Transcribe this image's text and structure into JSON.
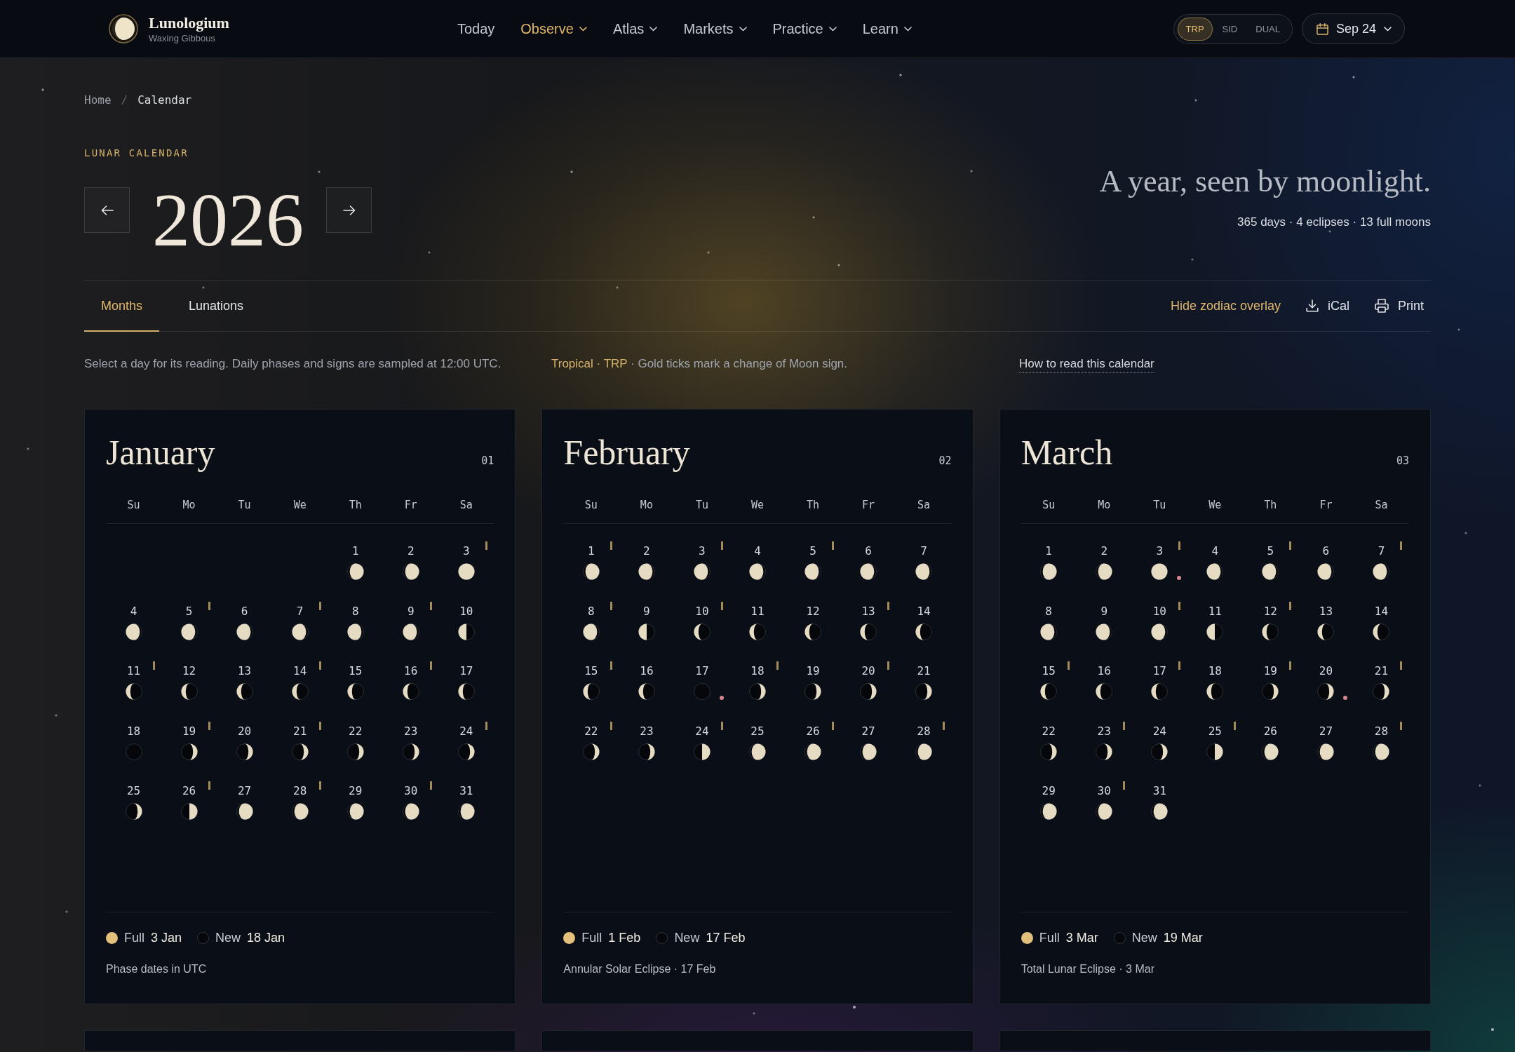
{
  "header": {
    "brand": {
      "name": "Lunologium",
      "subtitle": "Waxing Gibbous"
    },
    "nav": [
      {
        "label": "Today",
        "selected": false,
        "dropdown": false
      },
      {
        "label": "Observe",
        "selected": true,
        "dropdown": true
      },
      {
        "label": "Atlas",
        "selected": false,
        "dropdown": true
      },
      {
        "label": "Markets",
        "selected": false,
        "dropdown": true
      },
      {
        "label": "Practice",
        "selected": false,
        "dropdown": true
      },
      {
        "label": "Learn",
        "selected": false,
        "dropdown": true
      }
    ],
    "zodiac_modes": [
      {
        "label": "TRP",
        "selected": true
      },
      {
        "label": "SID",
        "selected": false
      },
      {
        "label": "DUAL",
        "selected": false
      }
    ],
    "date_button": {
      "label": "Sep 24"
    }
  },
  "breadcrumb": {
    "separator": "/",
    "items": [
      {
        "label": "Home",
        "current": false
      },
      {
        "label": "Calendar",
        "current": true
      }
    ]
  },
  "hero": {
    "eyebrow": "LUNAR CALENDAR",
    "year": "2026",
    "tagline": "A year, seen by moonlight.",
    "stats": "365 days · 4 eclipses · 13 full moons"
  },
  "view_tabs": [
    {
      "label": "Months",
      "selected": true
    },
    {
      "label": "Lunations",
      "selected": false
    }
  ],
  "actions": [
    {
      "kind": "toggle",
      "label": "Hide zodiac overlay"
    },
    {
      "kind": "download",
      "label": "iCal"
    },
    {
      "kind": "print",
      "label": "Print"
    }
  ],
  "info": {
    "note": "Select a day for its reading. Daily phases and signs are sampled at 12:00 UTC.",
    "zodiac": "Tropical · TRP",
    "zodiac_note": "· Gold ticks mark a change of Moon sign.",
    "help_link": "How to read this calendar"
  },
  "months": [
    {
      "kind": "month",
      "name": "January",
      "number": "01",
      "weekdays": [
        "Su",
        "Mo",
        "Tu",
        "We",
        "Th",
        "Fr",
        "Sa"
      ],
      "days": [
        {
          "kind": "blank"
        },
        {
          "kind": "blank"
        },
        {
          "kind": "blank"
        },
        {
          "kind": "blank"
        },
        {
          "kind": "waxing-gibbous",
          "label": "1",
          "tick": false,
          "event": false
        },
        {
          "kind": "waxing-gibbous",
          "label": "2",
          "tick": false,
          "event": false
        },
        {
          "kind": "full",
          "label": "3",
          "tick": true,
          "event": false
        },
        {
          "kind": "waning-gibbous",
          "label": "4",
          "tick": false,
          "event": false
        },
        {
          "kind": "waning-gibbous",
          "label": "5",
          "tick": true,
          "event": false
        },
        {
          "kind": "waning-gibbous",
          "label": "6",
          "tick": false,
          "event": false
        },
        {
          "kind": "waning-gibbous",
          "label": "7",
          "tick": true,
          "event": false
        },
        {
          "kind": "waning-gibbous",
          "label": "8",
          "tick": false,
          "event": false
        },
        {
          "kind": "waning-gibbous",
          "label": "9",
          "tick": true,
          "event": false
        },
        {
          "kind": "last-quarter",
          "label": "10",
          "tick": false,
          "event": false
        },
        {
          "kind": "waning-crescent",
          "label": "11",
          "tick": true,
          "event": false
        },
        {
          "kind": "waning-crescent",
          "label": "12",
          "tick": false,
          "event": false
        },
        {
          "kind": "waning-crescent",
          "label": "13",
          "tick": false,
          "event": false
        },
        {
          "kind": "waning-crescent",
          "label": "14",
          "tick": true,
          "event": false
        },
        {
          "kind": "waning-crescent",
          "label": "15",
          "tick": false,
          "event": false
        },
        {
          "kind": "waning-crescent",
          "label": "16",
          "tick": true,
          "event": false
        },
        {
          "kind": "waning-crescent",
          "label": "17",
          "tick": false,
          "event": false
        },
        {
          "kind": "new",
          "label": "18",
          "tick": false,
          "event": false
        },
        {
          "kind": "waxing-crescent",
          "label": "19",
          "tick": true,
          "event": false
        },
        {
          "kind": "waxing-crescent",
          "label": "20",
          "tick": false,
          "event": false
        },
        {
          "kind": "waxing-crescent",
          "label": "21",
          "tick": true,
          "event": false
        },
        {
          "kind": "waxing-crescent",
          "label": "22",
          "tick": false,
          "event": false
        },
        {
          "kind": "waxing-crescent",
          "label": "23",
          "tick": false,
          "event": false
        },
        {
          "kind": "waxing-crescent",
          "label": "24",
          "tick": true,
          "event": false
        },
        {
          "kind": "waxing-crescent",
          "label": "25",
          "tick": false,
          "event": false
        },
        {
          "kind": "first-quarter",
          "label": "26",
          "tick": true,
          "event": false
        },
        {
          "kind": "waxing-gibbous",
          "label": "27",
          "tick": false,
          "event": false
        },
        {
          "kind": "waxing-gibbous",
          "label": "28",
          "tick": true,
          "event": false
        },
        {
          "kind": "waxing-gibbous",
          "label": "29",
          "tick": false,
          "event": false
        },
        {
          "kind": "waxing-gibbous",
          "label": "30",
          "tick": true,
          "event": false
        },
        {
          "kind": "waxing-gibbous",
          "label": "31",
          "tick": false,
          "event": false
        }
      ],
      "legend": [
        {
          "kind": "full",
          "label": "Full",
          "date": "3 Jan"
        },
        {
          "kind": "new",
          "label": "New",
          "date": "18 Jan"
        }
      ],
      "note": "Phase dates in UTC"
    },
    {
      "kind": "month",
      "name": "February",
      "number": "02",
      "weekdays": [
        "Su",
        "Mo",
        "Tu",
        "We",
        "Th",
        "Fr",
        "Sa"
      ],
      "days": [
        {
          "kind": "waxing-gibbous",
          "label": "1",
          "tick": true,
          "event": false
        },
        {
          "kind": "waning-gibbous",
          "label": "2",
          "tick": false,
          "event": false
        },
        {
          "kind": "waning-gibbous",
          "label": "3",
          "tick": true,
          "event": false
        },
        {
          "kind": "waning-gibbous",
          "label": "4",
          "tick": false,
          "event": false
        },
        {
          "kind": "waning-gibbous",
          "label": "5",
          "tick": true,
          "event": false
        },
        {
          "kind": "waning-gibbous",
          "label": "6",
          "tick": false,
          "event": false
        },
        {
          "kind": "waning-gibbous",
          "label": "7",
          "tick": false,
          "event": false
        },
        {
          "kind": "waning-gibbous",
          "label": "8",
          "tick": true,
          "event": false
        },
        {
          "kind": "last-quarter",
          "label": "9",
          "tick": false,
          "event": false
        },
        {
          "kind": "waning-crescent",
          "label": "10",
          "tick": true,
          "event": false
        },
        {
          "kind": "waning-crescent",
          "label": "11",
          "tick": false,
          "event": false
        },
        {
          "kind": "waning-crescent",
          "label": "12",
          "tick": false,
          "event": false
        },
        {
          "kind": "waning-crescent",
          "label": "13",
          "tick": true,
          "event": false
        },
        {
          "kind": "waning-crescent",
          "label": "14",
          "tick": false,
          "event": false
        },
        {
          "kind": "waning-crescent",
          "label": "15",
          "tick": true,
          "event": false
        },
        {
          "kind": "waning-crescent",
          "label": "16",
          "tick": false,
          "event": false
        },
        {
          "kind": "new",
          "label": "17",
          "tick": false,
          "event": true
        },
        {
          "kind": "waxing-crescent",
          "label": "18",
          "tick": true,
          "event": false
        },
        {
          "kind": "waxing-crescent",
          "label": "19",
          "tick": false,
          "event": false
        },
        {
          "kind": "waxing-crescent",
          "label": "20",
          "tick": true,
          "event": false
        },
        {
          "kind": "waxing-crescent",
          "label": "21",
          "tick": false,
          "event": false
        },
        {
          "kind": "waxing-crescent",
          "label": "22",
          "tick": true,
          "event": false
        },
        {
          "kind": "waxing-crescent",
          "label": "23",
          "tick": false,
          "event": false
        },
        {
          "kind": "first-quarter",
          "label": "24",
          "tick": true,
          "event": false
        },
        {
          "kind": "waxing-gibbous",
          "label": "25",
          "tick": false,
          "event": false
        },
        {
          "kind": "waxing-gibbous",
          "label": "26",
          "tick": true,
          "event": false
        },
        {
          "kind": "waxing-gibbous",
          "label": "27",
          "tick": false,
          "event": false
        },
        {
          "kind": "waxing-gibbous",
          "label": "28",
          "tick": true,
          "event": false
        }
      ],
      "legend": [
        {
          "kind": "full",
          "label": "Full",
          "date": "1 Feb"
        },
        {
          "kind": "new",
          "label": "New",
          "date": "17 Feb"
        }
      ],
      "note": "Annular Solar Eclipse · 17 Feb"
    },
    {
      "kind": "month",
      "name": "March",
      "number": "03",
      "weekdays": [
        "Su",
        "Mo",
        "Tu",
        "We",
        "Th",
        "Fr",
        "Sa"
      ],
      "days": [
        {
          "kind": "waxing-gibbous",
          "label": "1",
          "tick": false,
          "event": false
        },
        {
          "kind": "waxing-gibbous",
          "label": "2",
          "tick": false,
          "event": false
        },
        {
          "kind": "full",
          "label": "3",
          "tick": true,
          "event": true
        },
        {
          "kind": "waning-gibbous",
          "label": "4",
          "tick": false,
          "event": false
        },
        {
          "kind": "waning-gibbous",
          "label": "5",
          "tick": true,
          "event": false
        },
        {
          "kind": "waning-gibbous",
          "label": "6",
          "tick": false,
          "event": false
        },
        {
          "kind": "waning-gibbous",
          "label": "7",
          "tick": true,
          "event": false
        },
        {
          "kind": "waning-gibbous",
          "label": "8",
          "tick": false,
          "event": false
        },
        {
          "kind": "waning-gibbous",
          "label": "9",
          "tick": false,
          "event": false
        },
        {
          "kind": "waning-gibbous",
          "label": "10",
          "tick": true,
          "event": false
        },
        {
          "kind": "last-quarter",
          "label": "11",
          "tick": false,
          "event": false
        },
        {
          "kind": "waning-crescent",
          "label": "12",
          "tick": true,
          "event": false
        },
        {
          "kind": "waning-crescent",
          "label": "13",
          "tick": false,
          "event": false
        },
        {
          "kind": "waning-crescent",
          "label": "14",
          "tick": false,
          "event": false
        },
        {
          "kind": "waning-crescent",
          "label": "15",
          "tick": true,
          "event": false
        },
        {
          "kind": "waning-crescent",
          "label": "16",
          "tick": false,
          "event": false
        },
        {
          "kind": "waning-crescent",
          "label": "17",
          "tick": true,
          "event": false
        },
        {
          "kind": "waning-crescent",
          "label": "18",
          "tick": false,
          "event": false
        },
        {
          "kind": "waxing-crescent",
          "label": "19",
          "tick": true,
          "event": false
        },
        {
          "kind": "waxing-crescent",
          "label": "20",
          "tick": false,
          "event": true
        },
        {
          "kind": "waxing-crescent",
          "label": "21",
          "tick": true,
          "event": false
        },
        {
          "kind": "waxing-crescent",
          "label": "22",
          "tick": false,
          "event": false
        },
        {
          "kind": "waxing-crescent",
          "label": "23",
          "tick": true,
          "event": false
        },
        {
          "kind": "waxing-crescent",
          "label": "24",
          "tick": false,
          "event": false
        },
        {
          "kind": "first-quarter",
          "label": "25",
          "tick": true,
          "event": false
        },
        {
          "kind": "waxing-gibbous",
          "label": "26",
          "tick": false,
          "event": false
        },
        {
          "kind": "waxing-gibbous",
          "label": "27",
          "tick": false,
          "event": false
        },
        {
          "kind": "waxing-gibbous",
          "label": "28",
          "tick": true,
          "event": false
        },
        {
          "kind": "waxing-gibbous",
          "label": "29",
          "tick": false,
          "event": false
        },
        {
          "kind": "waxing-gibbous",
          "label": "30",
          "tick": true,
          "event": false
        },
        {
          "kind": "waxing-gibbous",
          "label": "31",
          "tick": false,
          "event": false
        }
      ],
      "legend": [
        {
          "kind": "full",
          "label": "Full",
          "date": "3 Mar"
        },
        {
          "kind": "new",
          "label": "New",
          "date": "19 Mar"
        }
      ],
      "note": "Total Lunar Eclipse · 3 Mar"
    },
    {
      "kind": "stub"
    },
    {
      "kind": "stub"
    },
    {
      "kind": "stub"
    }
  ]
}
